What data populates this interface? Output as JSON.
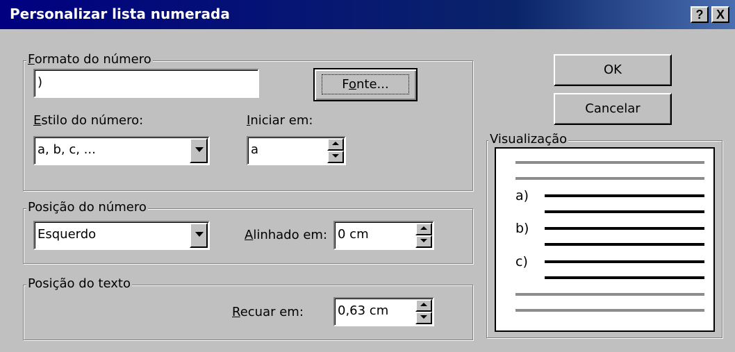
{
  "window": {
    "title": "Personalizar lista numerada",
    "help_label": "?",
    "close_label": "X"
  },
  "formato": {
    "group_label_u": "F",
    "group_label_rest": "ormato do número",
    "value": ")",
    "fonte_u": "o",
    "fonte_pre": "F",
    "fonte_post": "nte...",
    "estilo_label_u": "E",
    "estilo_label_rest": "stilo do número:",
    "estilo_value": "a, b, c, ...",
    "iniciar_label_u": "I",
    "iniciar_label_rest": "niciar em:",
    "iniciar_value": "a"
  },
  "posicao_numero": {
    "group_label": "Posição do número",
    "align_value": "Esquerdo",
    "alinhado_label_u": "A",
    "alinhado_label_rest": "linhado em:",
    "alinhado_value": "0 cm"
  },
  "posicao_texto": {
    "group_label": "Posição do texto",
    "recuar_label_u": "R",
    "recuar_label_rest": "ecuar em:",
    "recuar_value": "0,63 cm"
  },
  "buttons": {
    "ok": "OK",
    "cancel": "Cancelar"
  },
  "preview": {
    "label": "Visualização",
    "items": [
      "a)",
      "b)",
      "c)"
    ]
  },
  "colors": {
    "titlebar": "#000080",
    "face": "#c0c0c0",
    "preview_gray_line": "#8c8c8c",
    "preview_black_line": "#000000"
  }
}
